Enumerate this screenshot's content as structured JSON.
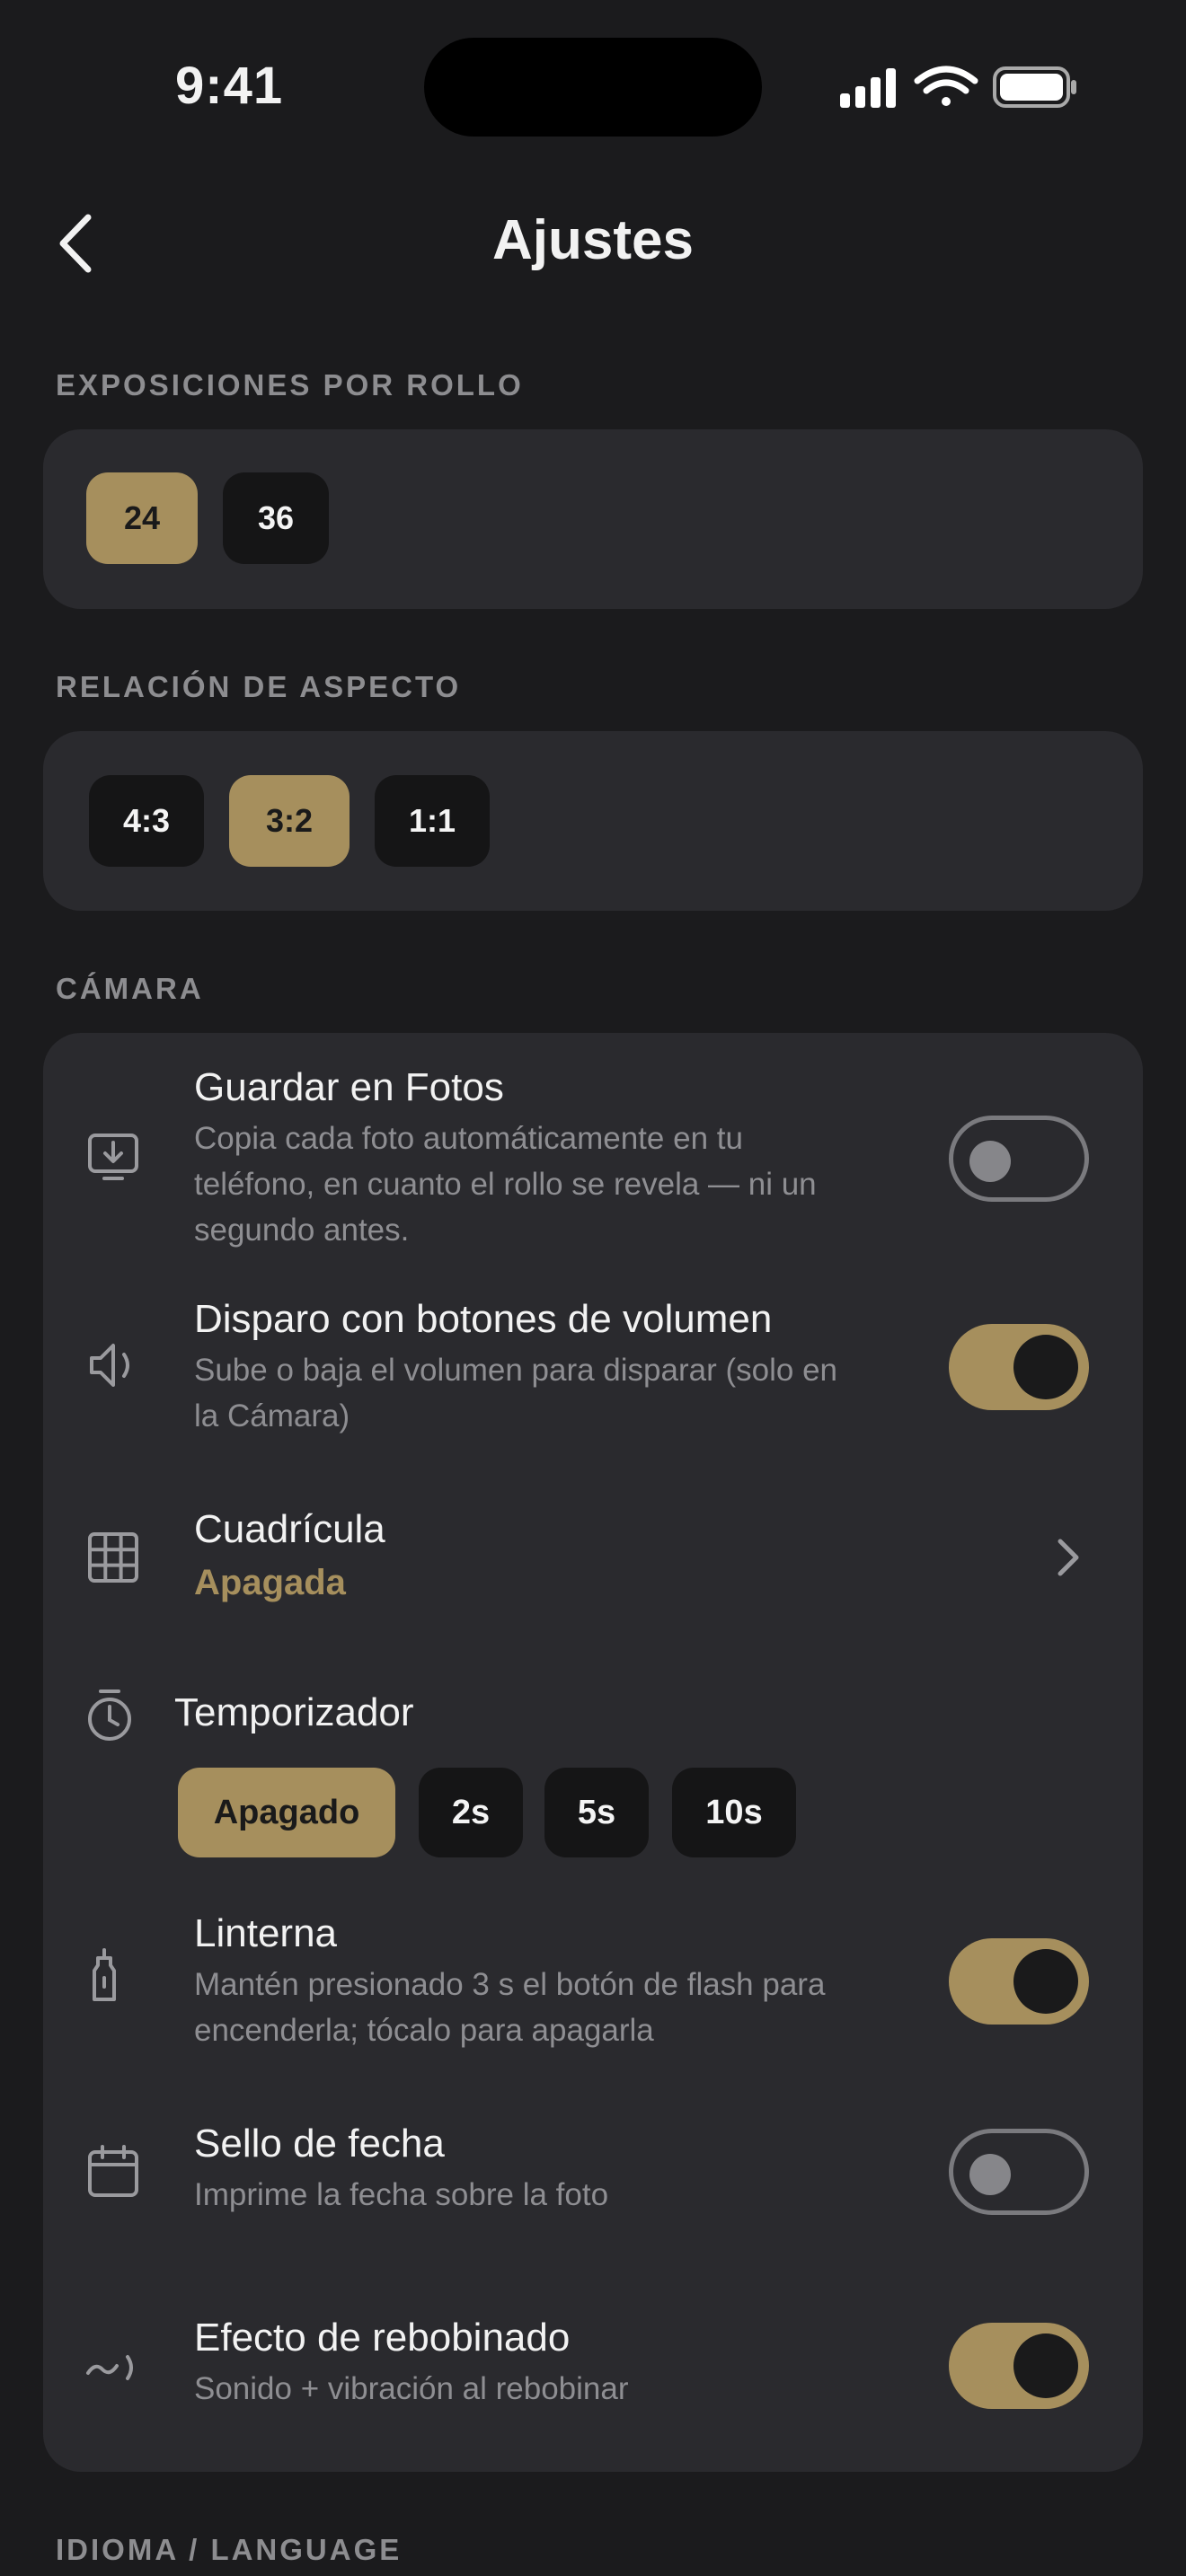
{
  "status_bar": {
    "time": "9:41"
  },
  "nav": {
    "title": "Ajustes"
  },
  "exposures": {
    "label": "EXPOSICIONES POR ROLLO",
    "options": [
      "24",
      "36"
    ],
    "selected": "24"
  },
  "aspect": {
    "label": "RELACIÓN DE ASPECTO",
    "options": [
      "4:3",
      "3:2",
      "1:1"
    ],
    "selected": "3:2"
  },
  "camera": {
    "label": "CÁMARA",
    "save_photos": {
      "title": "Guardar en Fotos",
      "desc_line1": "Copia cada foto automáticamente en tu",
      "desc_line2": "teléfono, en cuanto el rollo se revela — ni un",
      "desc_line3": "segundo antes.",
      "enabled": false
    },
    "volume_shutter": {
      "title": "Disparo con botones de volumen",
      "desc_line1": "Sube o baja el volumen para disparar (solo en",
      "desc_line2": "la Cámara)",
      "enabled": true
    },
    "grid": {
      "title": "Cuadrícula",
      "value": "Apagada"
    },
    "timer": {
      "title": "Temporizador",
      "options": [
        "Apagado",
        "2s",
        "5s",
        "10s"
      ],
      "selected": "Apagado"
    },
    "flashlight": {
      "title": "Linterna",
      "desc_line1": "Mantén presionado 3 s el botón de flash para",
      "desc_line2": "encenderla; tócalo para apagarla",
      "enabled": true
    },
    "date_stamp": {
      "title": "Sello de fecha",
      "desc": "Imprime la fecha sobre la foto",
      "enabled": false
    },
    "rewind": {
      "title": "Efecto de rebobinado",
      "desc": "Sonido + vibración al rebobinar",
      "enabled": true
    }
  },
  "language": {
    "label": "IDIOMA / LANGUAGE"
  },
  "colors": {
    "accent": "#a68f5d",
    "card": "#2a2a2e",
    "background": "#1b1b1d"
  }
}
